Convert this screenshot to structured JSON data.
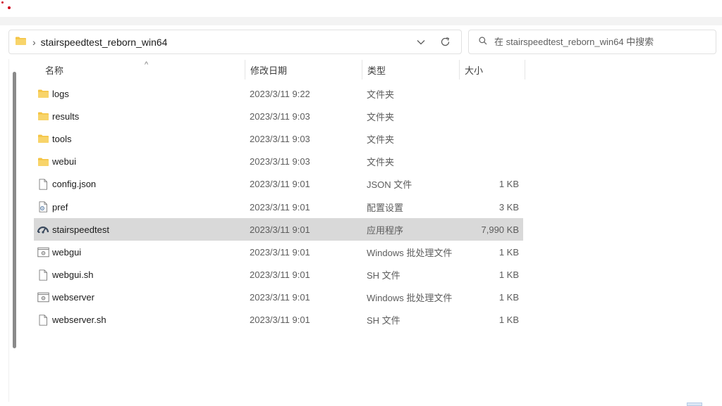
{
  "address_bar": {
    "path_label": "stairspeedtest_reborn_win64",
    "separator": "›",
    "chevron_glyph": "⌄",
    "refresh_glyph": "↻"
  },
  "search": {
    "placeholder": "在 stairspeedtest_reborn_win64 中搜索"
  },
  "columns": {
    "name": "名称",
    "date": "修改日期",
    "type": "类型",
    "size": "大小",
    "sort_indicator": "^"
  },
  "files": [
    {
      "name": "logs",
      "date": "2023/3/11 9:22",
      "type": "文件夹",
      "size": "",
      "icon": "folder-icon"
    },
    {
      "name": "results",
      "date": "2023/3/11 9:03",
      "type": "文件夹",
      "size": "",
      "icon": "folder-icon"
    },
    {
      "name": "tools",
      "date": "2023/3/11 9:03",
      "type": "文件夹",
      "size": "",
      "icon": "folder-icon"
    },
    {
      "name": "webui",
      "date": "2023/3/11 9:03",
      "type": "文件夹",
      "size": "",
      "icon": "folder-icon"
    },
    {
      "name": "config.json",
      "date": "2023/3/11 9:01",
      "type": "JSON 文件",
      "size": "1 KB",
      "icon": "file-icon"
    },
    {
      "name": "pref",
      "date": "2023/3/11 9:01",
      "type": "配置设置",
      "size": "3 KB",
      "icon": "settings-file-icon"
    },
    {
      "name": "stairspeedtest",
      "date": "2023/3/11 9:01",
      "type": "应用程序",
      "size": "7,990 KB",
      "icon": "speedometer-app-icon",
      "selected": true
    },
    {
      "name": "webgui",
      "date": "2023/3/11 9:01",
      "type": "Windows 批处理文件",
      "size": "1 KB",
      "icon": "batch-file-icon"
    },
    {
      "name": "webgui.sh",
      "date": "2023/3/11 9:01",
      "type": "SH 文件",
      "size": "1 KB",
      "icon": "file-icon"
    },
    {
      "name": "webserver",
      "date": "2023/3/11 9:01",
      "type": "Windows 批处理文件",
      "size": "1 KB",
      "icon": "batch-file-icon"
    },
    {
      "name": "webserver.sh",
      "date": "2023/3/11 9:01",
      "type": "SH 文件",
      "size": "1 KB",
      "icon": "file-icon"
    }
  ],
  "colors": {
    "folder": "#f4c342",
    "selection": "#d9d9d9",
    "accent_dot": "#d0021b"
  }
}
